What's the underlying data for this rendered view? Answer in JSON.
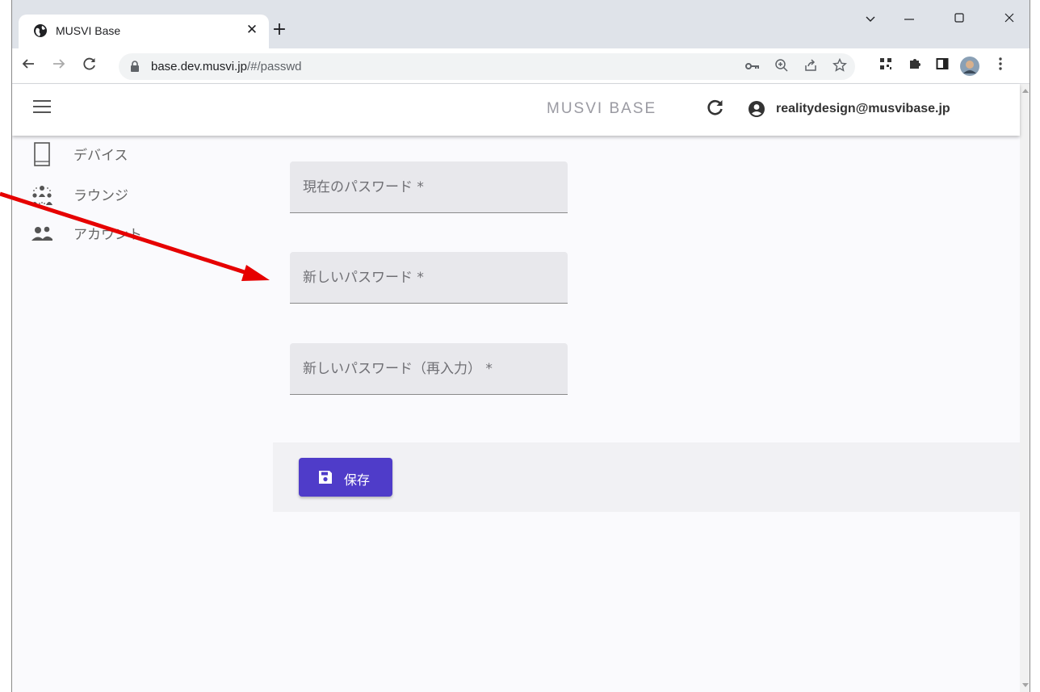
{
  "browser": {
    "tab_title": "MUSVI Base",
    "tab_close": "✕",
    "new_tab": "+",
    "url_host": "base.dev.musvi.jp",
    "url_path": "/#/passwd"
  },
  "app": {
    "brand": "MUSVI BASE",
    "account_email": "realitydesign@musvibase.jp"
  },
  "sidebar": {
    "items": [
      {
        "label": "デバイス",
        "icon": "tablet-icon"
      },
      {
        "label": "ラウンジ",
        "icon": "lounge-people-icon"
      },
      {
        "label": "アカウント",
        "icon": "account-group-icon"
      }
    ]
  },
  "form": {
    "current_password_placeholder": "現在のパスワード *",
    "new_password_placeholder": "新しいパスワード *",
    "confirm_password_placeholder": "新しいパスワード（再入力） *",
    "save_label": "保存"
  },
  "colors": {
    "primary": "#4f3cc9",
    "annotation": "#e60000"
  }
}
